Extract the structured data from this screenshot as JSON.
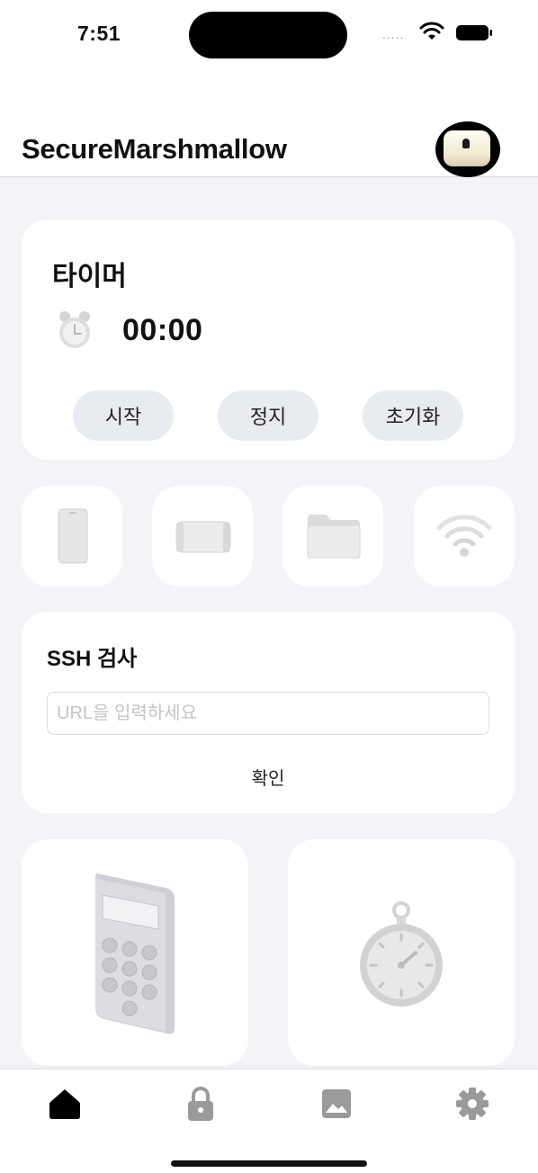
{
  "status_bar": {
    "time": "7:51",
    "signal": "....."
  },
  "header": {
    "title": "SecureMarshmallow"
  },
  "timer": {
    "title": "타이머",
    "value": "00:00",
    "buttons": {
      "start": "시작",
      "stop": "정지",
      "reset": "초기화"
    }
  },
  "quick_tiles": [
    {
      "icon": "phone-icon"
    },
    {
      "icon": "device-icon"
    },
    {
      "icon": "folder-icon"
    },
    {
      "icon": "wifi-icon"
    }
  ],
  "ssh": {
    "title": "SSH 검사",
    "input_value": "",
    "input_placeholder": "URL을 입력하세요",
    "confirm_label": "확인"
  },
  "feature_cards": [
    {
      "icon": "keypad-device-icon"
    },
    {
      "icon": "stopwatch-icon"
    }
  ],
  "tab_bar": {
    "active": "home",
    "tabs": [
      "home-icon",
      "lock-icon",
      "gallery-icon",
      "settings-icon"
    ]
  },
  "colors": {
    "background": "#f3f4f8",
    "card": "#ffffff",
    "pill": "#e8ebf0",
    "tab_inactive": "#9a9a9a",
    "tab_active": "#000000"
  }
}
